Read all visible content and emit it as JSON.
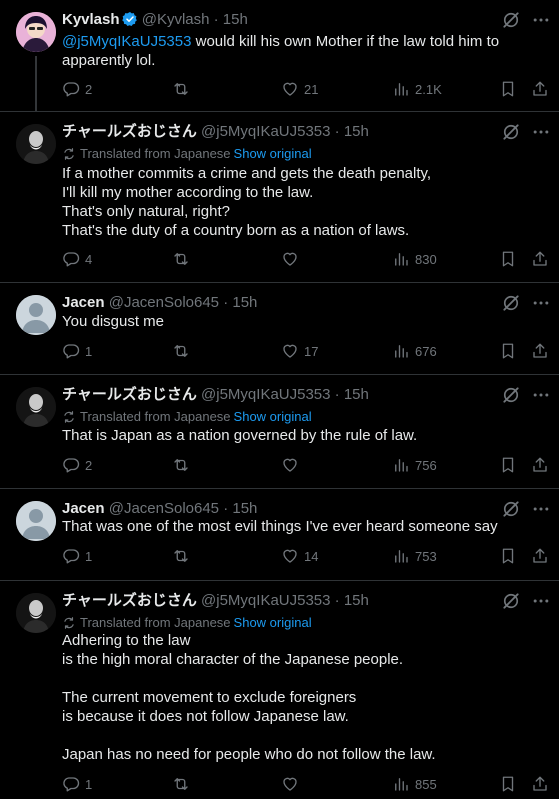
{
  "tweets": [
    {
      "name": "Kyvlash",
      "handle": "@Kyvlash",
      "time": "· 15h",
      "mention": "@j5MyqIKaUJ5353",
      "lines": [
        " would kill his own Mother if the law told him to",
        "apparently lol."
      ],
      "replies": "2",
      "reposts": "",
      "likes": "21",
      "views": "2.1K"
    },
    {
      "name": "チャールズおじさん",
      "handle": "@j5MyqIKaUJ5353",
      "time": "· 15h",
      "translated": "Translated from Japanese",
      "show_original": "Show original",
      "lines": [
        "If a mother commits a crime and gets the death penalty,",
        "I'll kill my mother according to the law.",
        "That's only natural, right?",
        "That's the duty of a country born as a nation of laws."
      ],
      "replies": "4",
      "reposts": "",
      "likes": "",
      "views": "830"
    },
    {
      "name": "Jacen",
      "handle": "@JacenSolo645",
      "time": "· 15h",
      "lines": [
        "You disgust me"
      ],
      "replies": "1",
      "reposts": "",
      "likes": "17",
      "views": "676"
    },
    {
      "name": "チャールズおじさん",
      "handle": "@j5MyqIKaUJ5353",
      "time": "· 15h",
      "translated": "Translated from Japanese",
      "show_original": "Show original",
      "lines": [
        "That is Japan as a nation governed by the rule of law."
      ],
      "replies": "2",
      "reposts": "",
      "likes": "",
      "views": "756"
    },
    {
      "name": "Jacen",
      "handle": "@JacenSolo645",
      "time": "· 15h",
      "lines": [
        "That was one of the most evil things I've ever heard someone say"
      ],
      "replies": "1",
      "reposts": "",
      "likes": "14",
      "views": "753"
    },
    {
      "name": "チャールズおじさん",
      "handle": "@j5MyqIKaUJ5353",
      "time": "· 15h",
      "translated": "Translated from Japanese",
      "show_original": "Show original",
      "lines": [
        "Adhering to the law",
        "is the high moral character of the Japanese people.",
        "",
        "The current movement to exclude foreigners",
        "is because it does not follow Japanese law.",
        "",
        "Japan has no need for people who do not follow the law."
      ],
      "replies": "1",
      "reposts": "",
      "likes": "",
      "views": "855"
    }
  ],
  "colors": {
    "background": "#000000",
    "text": "#e7e9ea",
    "muted": "#71767b",
    "accent": "#1d9bf0",
    "separator": "#2f3336"
  },
  "icons": {
    "reply": "reply-icon",
    "repost": "repost-icon",
    "like": "heart-icon",
    "views": "views-icon",
    "bookmark": "bookmark-icon",
    "share": "share-icon",
    "grok": "grok-icon",
    "more": "more-icon",
    "translate": "translate-icon",
    "verified": "verified-icon"
  }
}
